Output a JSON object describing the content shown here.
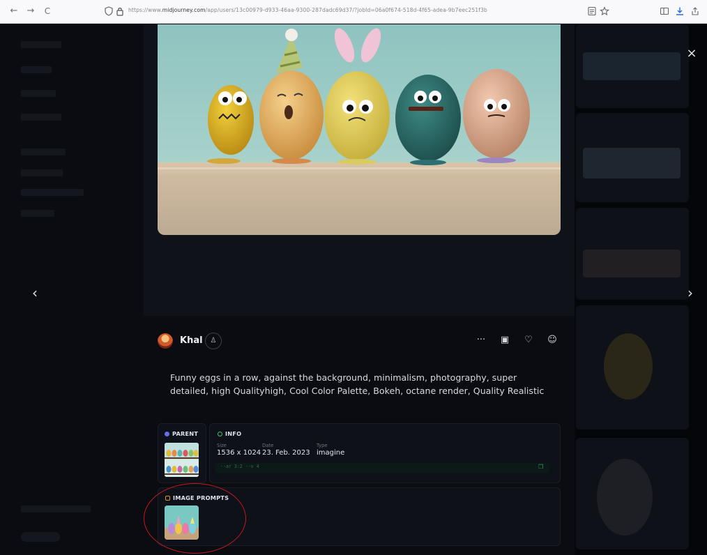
{
  "browser": {
    "back_icon": "←",
    "forward_icon": "→",
    "reload_icon": "C",
    "url_prefix": "https://www.",
    "url_domain": "midjourney.com",
    "url_path": "/app/users/13c00979-d933-46aa-9300-287dadc69d37/?jobId=06a0f674-518d-4f65-adea-9b7eec251f3b"
  },
  "viewer": {
    "close_icon": "×",
    "prev_icon": "‹",
    "next_icon": "›"
  },
  "user": {
    "name": "Khal",
    "follow_icon": "♙"
  },
  "actions": {
    "more": "···",
    "save": "▣",
    "like": "♡",
    "react": "☺"
  },
  "prompt_text": "Funny eggs in a row, against the background, minimalism, photography, super detailed, high Qualityhigh, Cool Color Palette, Bokeh, octane render, Quality Realistic",
  "parent_card": {
    "label": "PARENT"
  },
  "info_card": {
    "label": "INFO",
    "size_label": "Size",
    "size_value": "1536 x 1024",
    "date_label": "Date",
    "date_value": "23. Feb. 2023",
    "type_label": "Type",
    "type_value": "imagine",
    "params": "--ar 3:2 --v 4"
  },
  "image_prompts_card": {
    "label": "IMAGE PROMPTS"
  },
  "colors": {
    "accent_green": "#3fbf7f",
    "accent_orange": "#e2913a",
    "accent_purple": "#6c6cf0",
    "annotation_red": "#c2191f"
  }
}
